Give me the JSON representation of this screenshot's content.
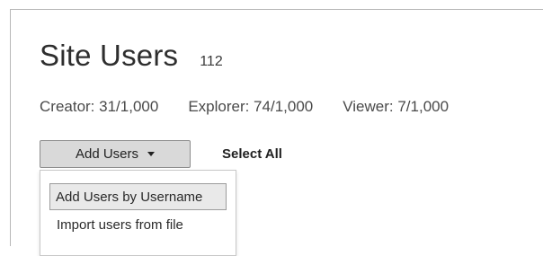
{
  "header": {
    "title": "Site Users",
    "count": "112"
  },
  "licenses": [
    {
      "label": "Creator: 31/1,000"
    },
    {
      "label": "Explorer: 74/1,000"
    },
    {
      "label": "Viewer: 7/1,000"
    }
  ],
  "toolbar": {
    "add_users_label": "Add Users",
    "select_all_label": "Select All"
  },
  "dropdown": {
    "items": [
      {
        "label": "Add Users by Username",
        "highlighted": true
      },
      {
        "label": "Import users from file",
        "highlighted": false
      }
    ]
  },
  "icons": {
    "caret": "chevron-down-icon"
  },
  "colors": {
    "button_bg": "#d9d9d9",
    "highlight_bg": "#e9e9e9",
    "text": "#333333"
  }
}
